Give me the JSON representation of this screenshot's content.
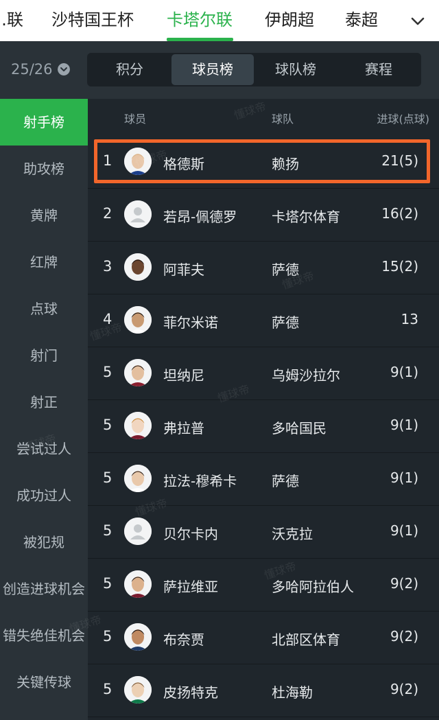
{
  "leagues": {
    "tabs": [
      {
        "label": "…联"
      },
      {
        "label": "沙特国王杯"
      },
      {
        "label": "卡塔尔联",
        "active": true
      },
      {
        "label": "伊朗超"
      },
      {
        "label": "泰超"
      }
    ]
  },
  "season": {
    "label": "25/26"
  },
  "segments": [
    {
      "label": "积分"
    },
    {
      "label": "球员榜",
      "active": true
    },
    {
      "label": "球队榜"
    },
    {
      "label": "赛程"
    }
  ],
  "sidebar": {
    "items": [
      {
        "label": "射手榜",
        "active": true
      },
      {
        "label": "助攻榜"
      },
      {
        "label": "黄牌"
      },
      {
        "label": "红牌"
      },
      {
        "label": "点球"
      },
      {
        "label": "射门"
      },
      {
        "label": "射正"
      },
      {
        "label": "尝试过人"
      },
      {
        "label": "成功过人"
      },
      {
        "label": "被犯规"
      },
      {
        "label": "创造进球机会"
      },
      {
        "label": "错失绝佳机会"
      },
      {
        "label": "关键传球"
      }
    ]
  },
  "table": {
    "headers": {
      "player": "球员",
      "team": "球队",
      "goals": "进球(点球)"
    },
    "rows": [
      {
        "rank": "1",
        "player": "格德斯",
        "team": "赖扬",
        "goals": "21(5)"
      },
      {
        "rank": "2",
        "player": "若昂-佩德罗",
        "team": "卡塔尔体育",
        "goals": "16(2)"
      },
      {
        "rank": "3",
        "player": "阿菲夫",
        "team": "萨德",
        "goals": "15(2)"
      },
      {
        "rank": "4",
        "player": "菲尔米诺",
        "team": "萨德",
        "goals": "13"
      },
      {
        "rank": "5",
        "player": "坦纳尼",
        "team": "乌姆沙拉尔",
        "goals": "9(1)"
      },
      {
        "rank": "5",
        "player": "弗拉普",
        "team": "多哈国民",
        "goals": "9(1)"
      },
      {
        "rank": "5",
        "player": "拉法-穆希卡",
        "team": "萨德",
        "goals": "9(1)"
      },
      {
        "rank": "5",
        "player": "贝尔卡内",
        "team": "沃克拉",
        "goals": "9(1)"
      },
      {
        "rank": "5",
        "player": "萨拉维亚",
        "team": "多哈阿拉伯人",
        "goals": "9(2)"
      },
      {
        "rank": "5",
        "player": "布奈贾",
        "team": "北部区体育",
        "goals": "9(2)"
      },
      {
        "rank": "5",
        "player": "皮扬特克",
        "team": "杜海勒",
        "goals": "9(2)"
      }
    ]
  },
  "watermark": "懂球帝",
  "colors": {
    "accent": "#2bb24c",
    "highlight": "#f2662b",
    "background": "#1f262c",
    "panel": "#2a3238"
  }
}
